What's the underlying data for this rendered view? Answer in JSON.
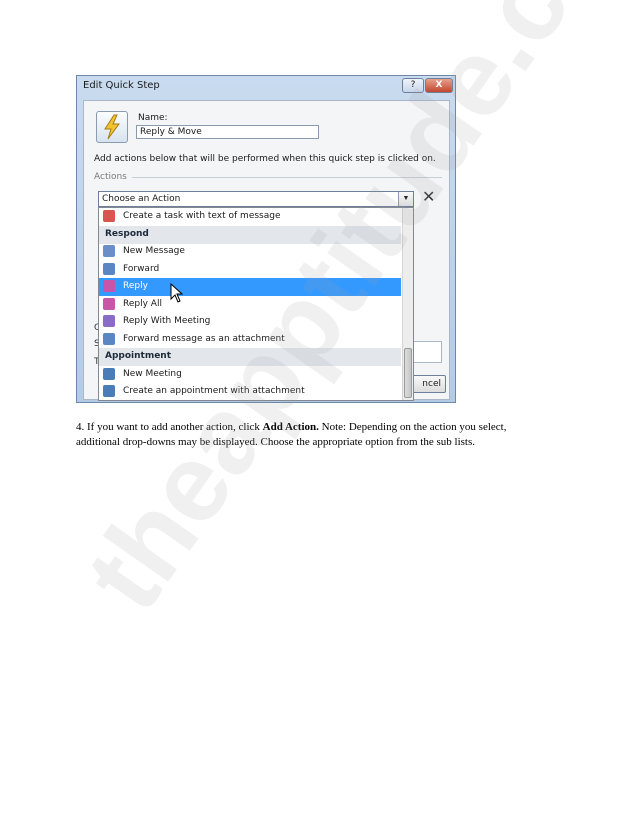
{
  "window": {
    "title": "Edit Quick Step",
    "help_label": "?",
    "close_label": "X"
  },
  "form": {
    "name_label": "Name:",
    "name_value": "Reply & Move",
    "instructions": "Add actions below that will be performed when this quick step is clicked on.",
    "actions_label": "Actions",
    "combo_value": "Choose an Action",
    "combo_arrow": "▼",
    "delete_label": "✕",
    "cancel_fragment": "ncel",
    "bg_frag_s": "S",
    "bg_frag_t": "T",
    "bg_frag_c": "C"
  },
  "dropdown": {
    "items": [
      {
        "type": "item",
        "label": "Create a task with text of message",
        "icon": "task-icon",
        "color": "#d9534f"
      },
      {
        "type": "header",
        "label": "Respond"
      },
      {
        "type": "item",
        "label": "New Message",
        "icon": "new-message-icon",
        "color": "#6a8fc8"
      },
      {
        "type": "item",
        "label": "Forward",
        "icon": "forward-icon",
        "color": "#5b86c4"
      },
      {
        "type": "item",
        "label": "Reply",
        "icon": "reply-icon",
        "color": "#c855a8",
        "selected": true
      },
      {
        "type": "item",
        "label": "Reply All",
        "icon": "reply-all-icon",
        "color": "#c855a8"
      },
      {
        "type": "item",
        "label": "Reply With Meeting",
        "icon": "reply-meeting-icon",
        "color": "#8a6cc8"
      },
      {
        "type": "item",
        "label": "Forward message as an attachment",
        "icon": "forward-attachment-icon",
        "color": "#5b86c4"
      },
      {
        "type": "header",
        "label": "Appointment"
      },
      {
        "type": "item",
        "label": "New Meeting",
        "icon": "meeting-icon",
        "color": "#4a7db8"
      },
      {
        "type": "item",
        "label": "Create an appointment with attachment",
        "icon": "calendar-icon",
        "color": "#4a7db8"
      }
    ]
  },
  "document": {
    "intro": "4. If you want to add another action, click ",
    "bold": "Add Action.",
    "rest": " Note: Depending on the action you select, additional drop-downs may be displayed. Choose the appropriate option from the sub lists."
  },
  "watermark": {
    "text": "theapptitude.com"
  }
}
